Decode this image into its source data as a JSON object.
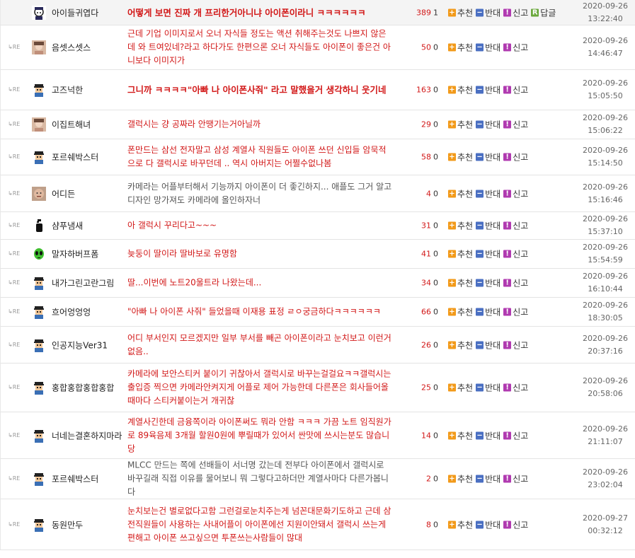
{
  "labels": {
    "recommend": "추천",
    "oppose": "반대",
    "report": "신고",
    "reply": "답글",
    "reply_mark": "RE"
  },
  "icons": {
    "recommend": "plus-icon",
    "oppose": "minus-icon",
    "report": "siren-icon",
    "reply": "reply-icon"
  },
  "comments": [
    {
      "nick": "아이들귀엽다",
      "avatar": "girl",
      "content": "어떻게 보면 진짜 개 프리한거아니냐 아이폰이라니 ㅋㅋㅋㅋㅋㅋ",
      "up": "389",
      "down": "1",
      "date": "2020-09-26",
      "time": "13:22:40",
      "is_reply": false,
      "style": "bold"
    },
    {
      "nick": "음셋스셋스",
      "avatar": "photo",
      "content": "근데 기업 이미지로서 오너 자식들 정도는 액션 취해주는것도 나쁘지 않은데 와 트여있네?라고 하다가도 한편으론 오너 자식들도 아이폰이 좋은건 아니보다 이미지가",
      "up": "50",
      "down": "0",
      "date": "2020-09-26",
      "time": "14:46:47",
      "is_reply": true,
      "style": "red"
    },
    {
      "nick": "고즈넉한",
      "avatar": "pixel",
      "content": "그니까 ㅋㅋㅋㅋ\"아빠 나 아이폰사줘\" 라고 말했을거 생각하니 웃기네",
      "up": "163",
      "down": "0",
      "date": "2020-09-26",
      "time": "15:05:50",
      "is_reply": true,
      "style": "bold"
    },
    {
      "nick": "이집트해녀",
      "avatar": "photo",
      "content": "갤럭시는 걍 공짜라 안땡기는거아닐까",
      "up": "29",
      "down": "0",
      "date": "2020-09-26",
      "time": "15:06:22",
      "is_reply": true,
      "style": "red"
    },
    {
      "nick": "포르쉐박스터",
      "avatar": "pixel",
      "content": "폰만드는 삼선 전자말고 삼성 계열사 직원들도 아이폰 쓰던 신입들 암묵적으로 다 갤럭시로 바꾸던데 .. 역시 아버지는 어쩔수없나봄",
      "up": "58",
      "down": "0",
      "date": "2020-09-26",
      "time": "15:14:50",
      "is_reply": true,
      "style": "red"
    },
    {
      "nick": "어디든",
      "avatar": "face",
      "content": "카메라는 어플부터해서 기능까지 아이폰이 더 좋긴하지... 애플도 그거 알고 디자인 망가져도 카메라에 올인하자너",
      "up": "4",
      "down": "0",
      "date": "2020-09-26",
      "time": "15:16:46",
      "is_reply": true,
      "style": "gray"
    },
    {
      "nick": "샴푸냄새",
      "avatar": "bottle",
      "content": "아 갤럭시 꾸리다고~~~",
      "up": "31",
      "down": "0",
      "date": "2020-09-26",
      "time": "15:37:10",
      "is_reply": true,
      "style": "red"
    },
    {
      "nick": "말자하버프폼",
      "avatar": "alien",
      "content": "늦둥이 딸이라 딸바보로 유명함",
      "up": "41",
      "down": "0",
      "date": "2020-09-26",
      "time": "15:54:59",
      "is_reply": true,
      "style": "red"
    },
    {
      "nick": "내가그린고란그림",
      "avatar": "pixel",
      "content": "딸...이번에 노트20울트라 나왔는데...",
      "up": "34",
      "down": "0",
      "date": "2020-09-26",
      "time": "16:10:44",
      "is_reply": true,
      "style": "red"
    },
    {
      "nick": "흐어엉엉엉",
      "avatar": "pixel",
      "content": "\"아빠 나 아이폰 사줘\" 들었을때 이재용 표정 ㄹㅇ궁금하다ㅋㅋㅋㅋㅋㅋ",
      "up": "66",
      "down": "0",
      "date": "2020-09-26",
      "time": "18:30:05",
      "is_reply": true,
      "style": "red"
    },
    {
      "nick": "인공지능Ver31",
      "avatar": "pixel",
      "content": "어디 부서인지 모르겠지만 일부 부서를 빼곤 아이폰이라고 눈치보고 이런거 없음..",
      "up": "26",
      "down": "0",
      "date": "2020-09-26",
      "time": "20:37:16",
      "is_reply": true,
      "style": "red"
    },
    {
      "nick": "홍합홍합홍합홍합",
      "avatar": "pixel",
      "content": "카메라에 보안스티커 붙이기 귀찮아서 갤럭시로 바꾸는걸걸요ㅋㅋ갤럭시는 출입증 찍으면 카메라안켜지게 어플로 제어 가능한데 다른폰은 회사들어올때마다 스티커붙이는거 개귀찮",
      "up": "25",
      "down": "0",
      "date": "2020-09-26",
      "time": "20:58:06",
      "is_reply": true,
      "style": "red"
    },
    {
      "nick": "너네는결혼하지마라",
      "avatar": "pixel",
      "content": "계열사긴한데 금융쪽이라 아이폰써도 뭐라 안함 ㅋㅋㅋ 가끔 노트 임직원가로 89육음제 3개월 할원0원에 뿌릴때가 있어서 싼맛에 쓰시는분도 많습니당",
      "up": "14",
      "down": "0",
      "date": "2020-09-26",
      "time": "21:11:07",
      "is_reply": true,
      "style": "red"
    },
    {
      "nick": "포르쉐박스터",
      "avatar": "pixel",
      "content": "MLCC 만드는 쪽에 선배들이 서너명 갔는데 전부다 아이폰에서 갤럭시로 바꾸길래 직접 이유를 물어보니 뭐 그렇다고하더만 계열사마다 다른가봅니다",
      "up": "2",
      "down": "0",
      "date": "2020-09-26",
      "time": "23:02:04",
      "is_reply": true,
      "style": "gray"
    },
    {
      "nick": "동원만두",
      "avatar": "pixel",
      "content": "눈치보는건 별로없다고함 그런걸로눈치주는게 넘꼰대문화기도하고 근데 삼전직원들이 사용하는 사내어플이 아이폰에선 지원이안돼서 갤럭시 쓰는게편해고 아이폰 쓰고싶으면 투폰쓰는사람들이 많대",
      "up": "8",
      "down": "0",
      "date": "2020-09-27",
      "time": "00:32:12",
      "is_reply": true,
      "style": "red"
    }
  ]
}
